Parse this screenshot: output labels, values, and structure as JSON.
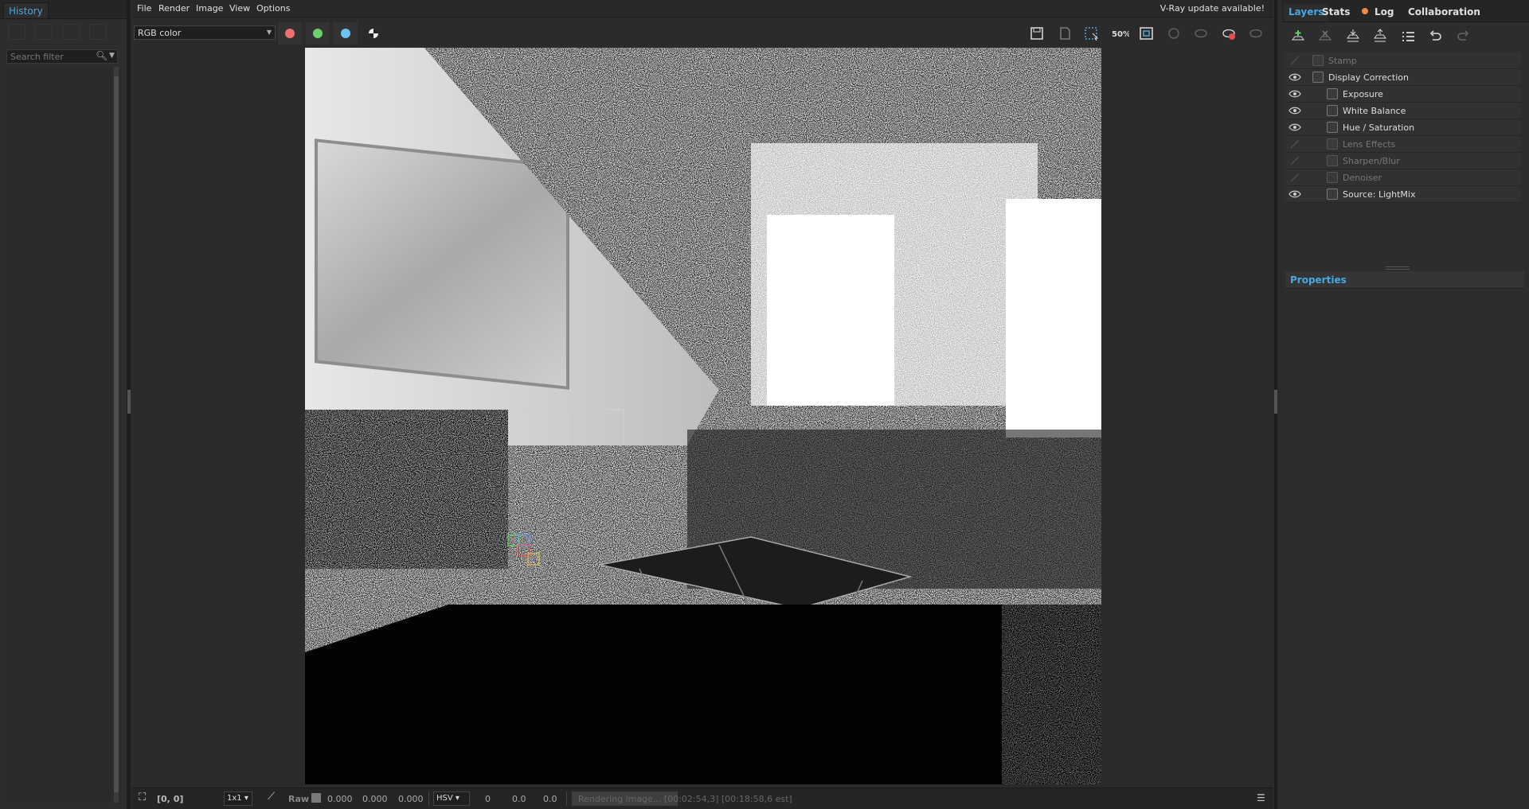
{
  "history": {
    "tab": "History",
    "search_placeholder": "Search filter"
  },
  "menu": {
    "items": [
      "File",
      "Render",
      "Image",
      "View",
      "Options"
    ],
    "update_notice": "V-Ray update available!"
  },
  "toolbar": {
    "channel_value": "RGB color",
    "color_dots": {
      "red": "#f07070",
      "green": "#6bd06b",
      "blue": "#6cc4f0"
    }
  },
  "statusbar": {
    "coords": "[0, 0]",
    "zoom_ratio": "1x1",
    "raw_label": "Raw",
    "rgb_values": [
      "0.000",
      "0.000",
      "0.000"
    ],
    "color_mode": "HSV",
    "hsv_values": [
      "0",
      "0.0",
      "0.0"
    ],
    "progress_text": "Rendering image... [00:02:54,3] [00:18:58,6 est]",
    "progress_fraction": 0.53
  },
  "layers_panel": {
    "tabs": [
      "Layers",
      "Stats",
      "Log",
      "Collaboration"
    ],
    "properties_title": "Properties",
    "layers": [
      {
        "name": "Stamp",
        "visible": false,
        "indent": 0,
        "icon": "stamp-icon"
      },
      {
        "name": "Display Correction",
        "visible": true,
        "indent": 0,
        "icon": "curve-icon"
      },
      {
        "name": "Exposure",
        "visible": true,
        "indent": 1,
        "icon": "exposure-icon"
      },
      {
        "name": "White Balance",
        "visible": true,
        "indent": 1,
        "icon": "white-balance-icon"
      },
      {
        "name": "Hue / Saturation",
        "visible": true,
        "indent": 1,
        "icon": "hue-saturation-icon"
      },
      {
        "name": "Lens Effects",
        "visible": false,
        "indent": 1,
        "icon": "lens-effects-icon"
      },
      {
        "name": "Sharpen/Blur",
        "visible": false,
        "indent": 1,
        "icon": "sharpen-icon"
      },
      {
        "name": "Denoiser",
        "visible": false,
        "indent": 1,
        "icon": "denoiser-icon"
      },
      {
        "name": "Source: LightMix",
        "visible": true,
        "indent": 1,
        "icon": "lightmix-icon"
      }
    ]
  },
  "colors": {
    "accent": "#4aa8e0",
    "log_dot": "#f28a3c",
    "panel_bg": "#2d2d2d"
  }
}
